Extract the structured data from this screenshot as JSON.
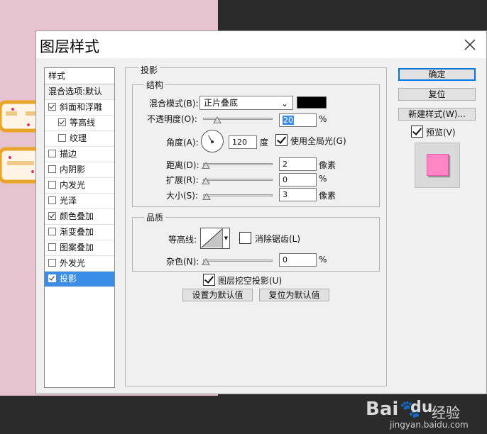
{
  "dialog": {
    "title": "图层样式"
  },
  "style_list": {
    "header": "样式",
    "blend_option": "混合选项:默认",
    "items": [
      {
        "label": "斜面和浮雕",
        "checked": true,
        "sub": false
      },
      {
        "label": "等高线",
        "checked": true,
        "sub": true
      },
      {
        "label": "纹理",
        "checked": false,
        "sub": true
      },
      {
        "label": "描边",
        "checked": false,
        "sub": false
      },
      {
        "label": "内阴影",
        "checked": false,
        "sub": false
      },
      {
        "label": "内发光",
        "checked": false,
        "sub": false
      },
      {
        "label": "光泽",
        "checked": false,
        "sub": false
      },
      {
        "label": "颜色叠加",
        "checked": true,
        "sub": false
      },
      {
        "label": "渐变叠加",
        "checked": false,
        "sub": false
      },
      {
        "label": "图案叠加",
        "checked": false,
        "sub": false
      },
      {
        "label": "外发光",
        "checked": false,
        "sub": false
      },
      {
        "label": "投影",
        "checked": true,
        "sub": false,
        "selected": true
      }
    ]
  },
  "drop_shadow": {
    "group_title": "投影",
    "structure": {
      "title": "结构",
      "blend_mode_label": "混合模式(B):",
      "blend_mode_value": "正片叠底",
      "shadow_color": "#000000",
      "opacity_label": "不透明度(O):",
      "opacity_value": "20",
      "opacity_unit": "%",
      "angle_label": "角度(A):",
      "angle_value": "120",
      "angle_unit": "度",
      "global_light_label": "使用全局光(G)",
      "global_light_checked": true,
      "distance_label": "距离(D):",
      "distance_value": "2",
      "distance_unit": "像素",
      "spread_label": "扩展(R):",
      "spread_value": "0",
      "spread_unit": "%",
      "size_label": "大小(S):",
      "size_value": "3",
      "size_unit": "像素"
    },
    "quality": {
      "title": "品质",
      "contour_label": "等高线:",
      "antialias_label": "消除锯齿(L)",
      "antialias_checked": false,
      "noise_label": "杂色(N):",
      "noise_value": "0",
      "noise_unit": "%"
    },
    "knockout_label": "图层挖空投影(U)",
    "knockout_checked": true,
    "make_default": "设置为默认值",
    "reset_default": "复位为默认值"
  },
  "buttons": {
    "ok": "确定",
    "reset": "复位",
    "new_style": "新建样式(W)...",
    "preview_label": "预览(V)",
    "preview_checked": true,
    "preview_color": "#ff85c7"
  },
  "watermark": {
    "brand": "Bai",
    "brand_suffix": "du",
    "cn": "经验",
    "url": "jingyan.baidu.com"
  }
}
